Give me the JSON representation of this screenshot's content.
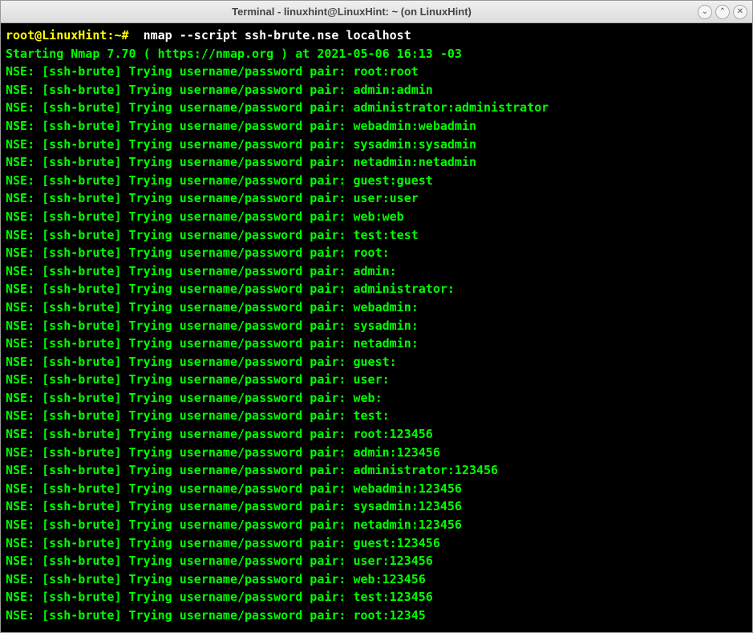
{
  "window": {
    "title": "Terminal - linuxhint@LinuxHint: ~ (on LinuxHint)"
  },
  "prompt": {
    "user_host": "root@LinuxHint",
    "path": ":~#",
    "command": "  nmap --script ssh-brute.nse localhost"
  },
  "starting_line": "Starting Nmap 7.70 ( https://nmap.org ) at 2021-05-06 16:13 -03",
  "nse_lines": [
    "NSE: [ssh-brute] Trying username/password pair: root:root",
    "NSE: [ssh-brute] Trying username/password pair: admin:admin",
    "NSE: [ssh-brute] Trying username/password pair: administrator:administrator",
    "NSE: [ssh-brute] Trying username/password pair: webadmin:webadmin",
    "NSE: [ssh-brute] Trying username/password pair: sysadmin:sysadmin",
    "NSE: [ssh-brute] Trying username/password pair: netadmin:netadmin",
    "NSE: [ssh-brute] Trying username/password pair: guest:guest",
    "NSE: [ssh-brute] Trying username/password pair: user:user",
    "NSE: [ssh-brute] Trying username/password pair: web:web",
    "NSE: [ssh-brute] Trying username/password pair: test:test",
    "NSE: [ssh-brute] Trying username/password pair: root:",
    "NSE: [ssh-brute] Trying username/password pair: admin:",
    "NSE: [ssh-brute] Trying username/password pair: administrator:",
    "NSE: [ssh-brute] Trying username/password pair: webadmin:",
    "NSE: [ssh-brute] Trying username/password pair: sysadmin:",
    "NSE: [ssh-brute] Trying username/password pair: netadmin:",
    "NSE: [ssh-brute] Trying username/password pair: guest:",
    "NSE: [ssh-brute] Trying username/password pair: user:",
    "NSE: [ssh-brute] Trying username/password pair: web:",
    "NSE: [ssh-brute] Trying username/password pair: test:",
    "NSE: [ssh-brute] Trying username/password pair: root:123456",
    "NSE: [ssh-brute] Trying username/password pair: admin:123456",
    "NSE: [ssh-brute] Trying username/password pair: administrator:123456",
    "NSE: [ssh-brute] Trying username/password pair: webadmin:123456",
    "NSE: [ssh-brute] Trying username/password pair: sysadmin:123456",
    "NSE: [ssh-brute] Trying username/password pair: netadmin:123456",
    "NSE: [ssh-brute] Trying username/password pair: guest:123456",
    "NSE: [ssh-brute] Trying username/password pair: user:123456",
    "NSE: [ssh-brute] Trying username/password pair: web:123456",
    "NSE: [ssh-brute] Trying username/password pair: test:123456",
    "NSE: [ssh-brute] Trying username/password pair: root:12345"
  ],
  "controls": {
    "minimize": "⌄",
    "maximize": "⌃",
    "close": "✕"
  }
}
